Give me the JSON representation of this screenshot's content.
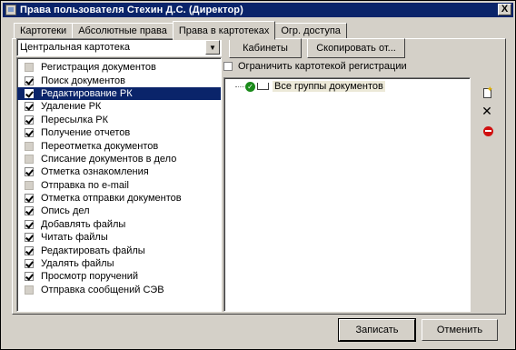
{
  "window": {
    "title": "Права пользователя Стехин Д.С. (Директор)",
    "close_label": "X"
  },
  "tabs": [
    {
      "label": "Картотеки",
      "active": false
    },
    {
      "label": "Абсолютные права",
      "active": false
    },
    {
      "label": "Права в картотеках",
      "active": true
    },
    {
      "label": "Огр. доступа",
      "active": false
    }
  ],
  "card_select": {
    "value": "Центральная картотека"
  },
  "buttons": {
    "cabinets": "Кабинеты",
    "copy_from": "Скопировать от...",
    "save": "Записать",
    "cancel": "Отменить"
  },
  "restrict_checkbox": {
    "label": "Ограничить картотекой регистрации",
    "checked": false
  },
  "rights": [
    {
      "label": "Регистрация документов",
      "state": "off"
    },
    {
      "label": "Поиск документов",
      "state": "on"
    },
    {
      "label": "Редактирование РК",
      "state": "on",
      "selected": true
    },
    {
      "label": "Удаление РК",
      "state": "on"
    },
    {
      "label": "Пересылка РК",
      "state": "on"
    },
    {
      "label": "Получение отчетов",
      "state": "on"
    },
    {
      "label": "Переотметка документов",
      "state": "off"
    },
    {
      "label": "Списание документов в дело",
      "state": "off"
    },
    {
      "label": "Отметка ознакомления",
      "state": "on"
    },
    {
      "label": "Отправка по e-mail",
      "state": "off"
    },
    {
      "label": "Отметка отправки документов",
      "state": "on"
    },
    {
      "label": "Опись дел",
      "state": "on"
    },
    {
      "label": "Добавлять файлы",
      "state": "on"
    },
    {
      "label": "Читать файлы",
      "state": "on"
    },
    {
      "label": "Редактировать файлы",
      "state": "on"
    },
    {
      "label": "Удалять файлы",
      "state": "on"
    },
    {
      "label": "Просмотр поручений",
      "state": "on"
    },
    {
      "label": "Отправка сообщений СЭВ",
      "state": "off"
    }
  ],
  "tree": {
    "root_label": "Все группы документов"
  },
  "colors": {
    "titlebar": "#0a246a",
    "face": "#d4d0c8",
    "selection": "#0a246a"
  }
}
